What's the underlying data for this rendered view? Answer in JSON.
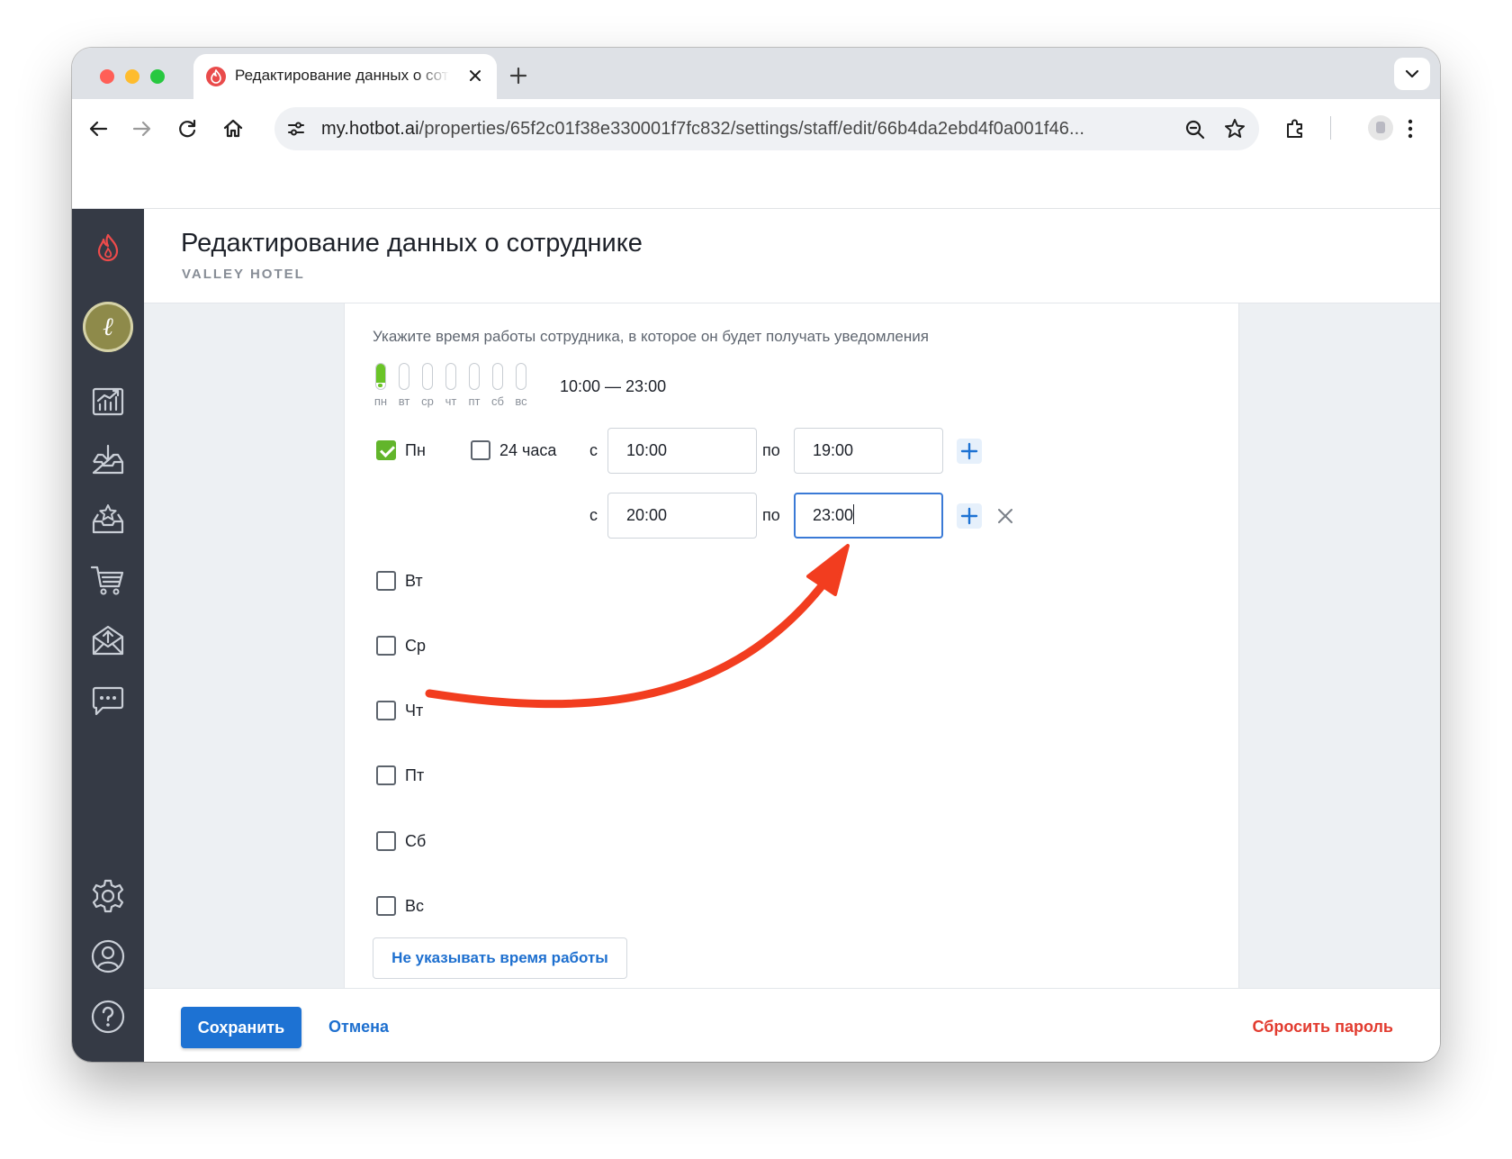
{
  "browser": {
    "tab_title": "Редактирование данных о сотруднике",
    "url_host": "my.hotbot.ai",
    "url_path": "/properties/65f2c01f38e330001f7fc832/settings/staff/edit/66b4da2ebd4f0a001f46..."
  },
  "icons": {
    "tab": [
      "hotbot-flame-icon",
      "close-icon",
      "new-tab-plus-icon",
      "tab-search-chevron-icon"
    ],
    "toolbar": [
      "back-arrow-icon",
      "forward-arrow-icon",
      "reload-icon",
      "home-icon",
      "site-settings-icon",
      "zoom-icon",
      "bookmark-star-icon",
      "extensions-icon",
      "profile-avatar-icon",
      "kebab-menu-icon"
    ],
    "sidebar": [
      "hotbot-flame-icon",
      "user-avatar",
      "analytics-chart-icon",
      "inbox-download-icon",
      "reviews-star-inbox-icon",
      "cart-icon",
      "mail-upload-icon",
      "chat-bubble-icon",
      "settings-gear-icon",
      "account-icon",
      "help-icon"
    ]
  },
  "page": {
    "title": "Редактирование данных о сотруднике",
    "subtitle": "VALLEY HOTEL"
  },
  "schedule": {
    "hint": "Укажите время работы сотрудника, в которое он будет получать уведомления",
    "summary_days": [
      {
        "label": "пн",
        "fill": 0.75
      },
      {
        "label": "вт",
        "fill": 0
      },
      {
        "label": "ср",
        "fill": 0
      },
      {
        "label": "чт",
        "fill": 0
      },
      {
        "label": "пт",
        "fill": 0
      },
      {
        "label": "сб",
        "fill": 0
      },
      {
        "label": "вс",
        "fill": 0
      }
    ],
    "summary_range": "10:00 — 23:00",
    "day_rows": [
      {
        "label": "Пн",
        "checked": true
      },
      {
        "label": "Вт",
        "checked": false
      },
      {
        "label": "Ср",
        "checked": false
      },
      {
        "label": "Чт",
        "checked": false
      },
      {
        "label": "Пт",
        "checked": false
      },
      {
        "label": "Сб",
        "checked": false
      },
      {
        "label": "Вс",
        "checked": false
      }
    ],
    "all_day_label": "24 часа",
    "from_label": "с",
    "to_label": "по",
    "intervals": [
      {
        "from": "10:00",
        "to": "19:00"
      },
      {
        "from": "20:00",
        "to": "23:00"
      }
    ],
    "no_schedule_button": "Не указывать время работы"
  },
  "footer": {
    "save": "Сохранить",
    "cancel": "Отмена",
    "reset_password": "Сбросить пароль"
  },
  "colors": {
    "accent": "#1d72d3",
    "danger": "#e23b2f",
    "success": "#62b52b",
    "sidebar": "#353a45",
    "annotation_arrow": "#f23d1f"
  }
}
